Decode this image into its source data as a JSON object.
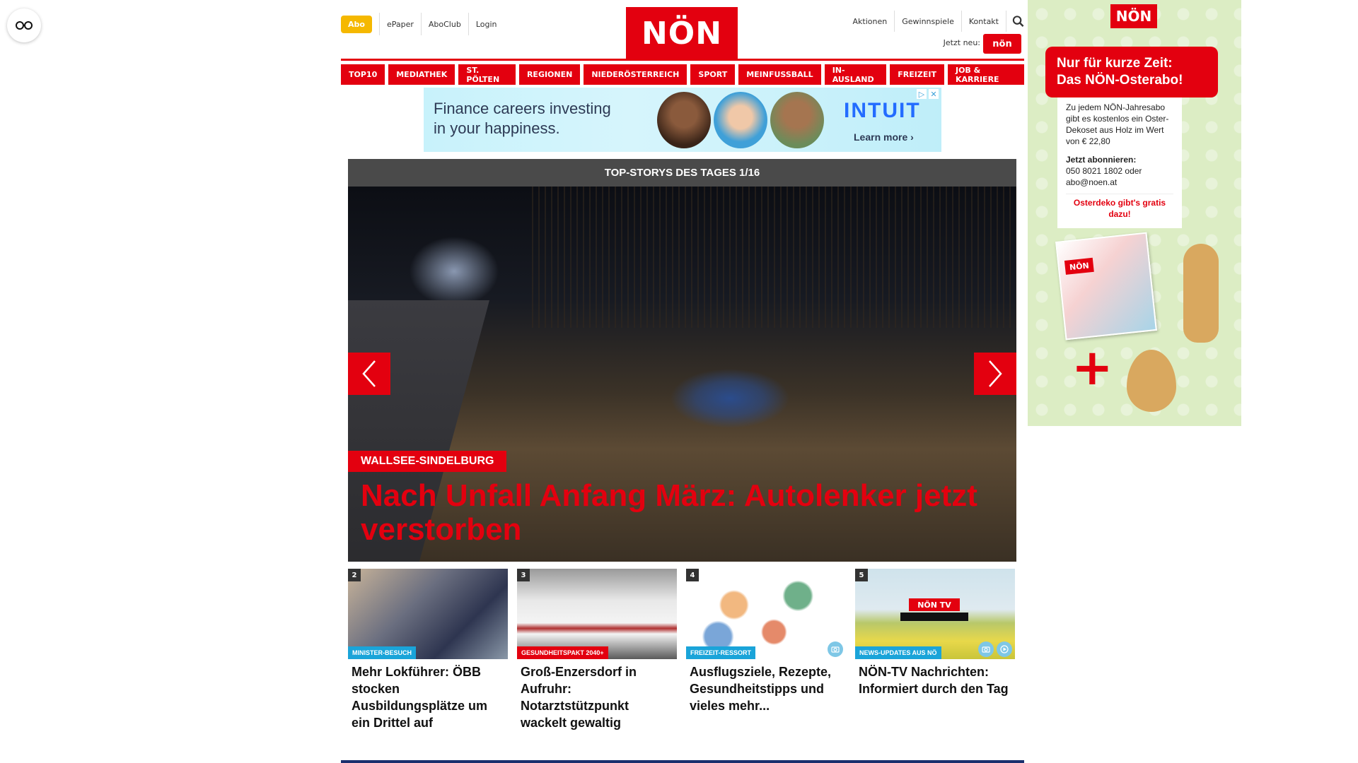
{
  "header": {
    "abo_label": "Abo",
    "links_left": [
      "ePaper",
      "AboClub",
      "Login"
    ],
    "logo_text": "NÖN",
    "links_right": [
      "Aktionen",
      "Gewinnspiele",
      "Kontakt"
    ],
    "jetzt_neu": "Jetzt neu:",
    "mini_logo_text": "nön"
  },
  "nav": [
    "TOP10",
    "MEDIATHEK",
    "ST. PÖLTEN",
    "REGIONEN",
    "NIEDERÖSTERREICH",
    "SPORT",
    "MEINFUSSBALL",
    "IN-AUSLAND",
    "FREIZEIT",
    "JOB & KARRIERE"
  ],
  "banner": {
    "line1": "Finance careers investing",
    "line2": "in your happiness.",
    "brand": "INTUIT",
    "cta": "Learn more ›"
  },
  "hero": {
    "header": "TOP-STORYS DES TAGES 1/16",
    "tag": "WALLSEE-SINDELBURG",
    "title": "Nach Unfall Anfang März: Autolenker jetzt verstorben"
  },
  "teasers": [
    {
      "num": "2",
      "badge": "MINISTER-BESUCH",
      "title": "Mehr Lokführer: ÖBB stocken Ausbildungsplätze um ein Drittel auf"
    },
    {
      "num": "3",
      "badge": "GESUNDHEITSPAKT 2040+",
      "title": "Groß-Enzersdorf in Aufruhr: Notarztstützpunkt wackelt gewaltig"
    },
    {
      "num": "4",
      "badge": "FREIZEIT-RESSORT",
      "title": "Ausflugsziele, Rezepte, Gesundheitstipps und vieles mehr..."
    },
    {
      "num": "5",
      "badge": "NEWS-UPDATES AUS NÖ",
      "title": "NÖN-TV Nachrichten: Informiert durch den Tag"
    }
  ],
  "sidebar_ad": {
    "logo": "NÖN",
    "headline_1": "Nur für kurze Zeit:",
    "headline_2": "Das NÖN-Osterabo!",
    "text_1": "Zu jedem NÖN-Jahresabo gibt es kostenlos ein Oster-Dekoset aus Holz im Wert von € 22,80",
    "text_2": "Jetzt abonnieren:",
    "text_3": "050 8021 1802 oder abo@noen.at",
    "text_4": "Osterdeko gibt's gratis dazu!",
    "plus": "+",
    "mag_logo": "NÖN"
  },
  "colors": {
    "brand_red": "#e3000f",
    "abo_yellow": "#f5b800",
    "badge_blue": "#1aa4d9",
    "footer_navy": "#1a2f6e"
  }
}
